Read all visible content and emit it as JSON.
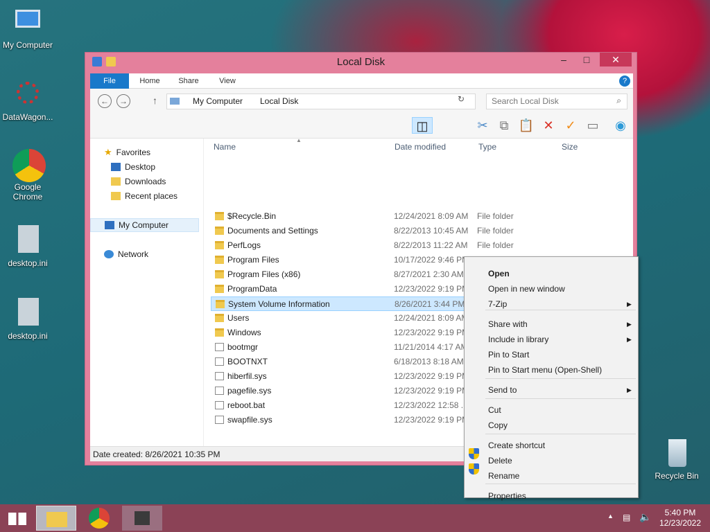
{
  "desktop": {
    "icons": [
      {
        "label": "My Computer"
      },
      {
        "label": "DataWagon..."
      },
      {
        "label": "Google Chrome"
      },
      {
        "label": "desktop.ini"
      },
      {
        "label": "desktop.ini"
      },
      {
        "label": "Recycle Bin"
      }
    ]
  },
  "window": {
    "title": "Local Disk",
    "ribbon_tabs": [
      "File",
      "Home",
      "Share",
      "View"
    ],
    "breadcrumb": [
      "My Computer",
      "Local Disk"
    ],
    "search_placeholder": "Search Local Disk"
  },
  "nav": {
    "favorites": "Favorites",
    "items": [
      "Desktop",
      "Downloads",
      "Recent places"
    ],
    "computer": "My Computer",
    "network": "Network"
  },
  "columns": {
    "name": "Name",
    "date": "Date modified",
    "type": "Type",
    "size": "Size"
  },
  "files": [
    {
      "name": "$Recycle.Bin",
      "date": "12/24/2021 8:09 AM",
      "type": "File folder"
    },
    {
      "name": "Documents and Settings",
      "date": "8/22/2013 10:45 AM",
      "type": "File folder"
    },
    {
      "name": "PerfLogs",
      "date": "8/22/2013 11:22 AM",
      "type": "File folder"
    },
    {
      "name": "Program Files",
      "date": "10/17/2022 9:46 PM",
      "type": "File folder"
    },
    {
      "name": "Program Files (x86)",
      "date": "8/27/2021 2:30 AM",
      "type": "File folder"
    },
    {
      "name": "ProgramData",
      "date": "12/23/2022 9:19 PM",
      "type": "File folder"
    },
    {
      "name": "System Volume Information",
      "date": "8/26/2021 3:44 PM",
      "type": "File folder"
    },
    {
      "name": "Users",
      "date": "12/24/2021 8:09 AM",
      "type": ""
    },
    {
      "name": "Windows",
      "date": "12/23/2022 9:19 PM",
      "type": ""
    },
    {
      "name": "bootmgr",
      "date": "11/21/2014 4:17 AM",
      "type": ""
    },
    {
      "name": "BOOTNXT",
      "date": "6/18/2013 8:18 AM",
      "type": ""
    },
    {
      "name": "hiberfil.sys",
      "date": "12/23/2022 9:19 PM",
      "type": ""
    },
    {
      "name": "pagefile.sys",
      "date": "12/23/2022 9:19 PM",
      "type": ""
    },
    {
      "name": "reboot.bat",
      "date": "12/23/2022 12:58 ...",
      "type": ""
    },
    {
      "name": "swapfile.sys",
      "date": "12/23/2022 9:19 PM",
      "type": ""
    }
  ],
  "status": "Date created: 8/26/2021 10:35 PM",
  "context_menu": [
    "Open",
    "Open in new window",
    "7-Zip",
    "Share with",
    "Include in library",
    "Pin to Start",
    "Pin to Start menu (Open-Shell)",
    "Send to",
    "Cut",
    "Copy",
    "Create shortcut",
    "Delete",
    "Rename",
    "Properties"
  ],
  "clock": {
    "time": "5:40 PM",
    "date": "12/23/2022"
  }
}
